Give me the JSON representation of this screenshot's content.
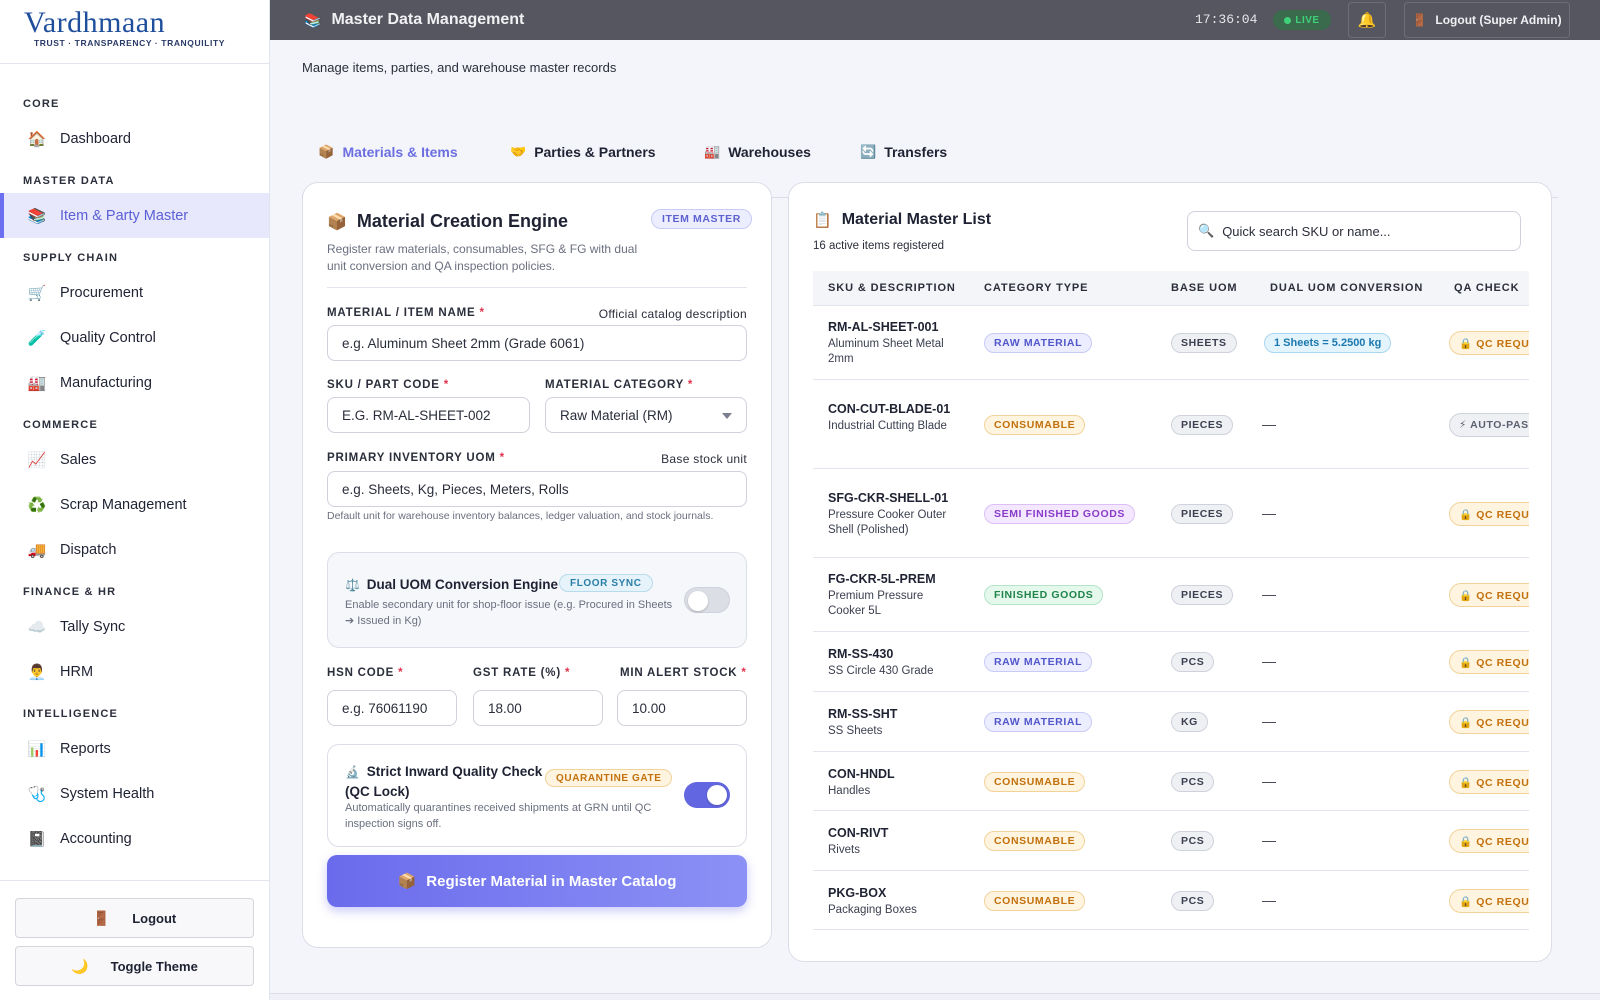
{
  "brand": {
    "name": "Vardhmaan",
    "tagline": "TRUST · TRANSPARENCY · TRANQUILITY",
    "accent": "#6c6ff0"
  },
  "sidebar": {
    "sections": {
      "core": "CORE",
      "master": "MASTER DATA",
      "supply": "SUPPLY CHAIN",
      "commerce": "COMMERCE",
      "finance": "FINANCE & HR",
      "intel": "INTELLIGENCE"
    },
    "items": {
      "dashboard": {
        "label": "Dashboard",
        "icon": "🏠"
      },
      "item_party": {
        "label": "Item & Party Master",
        "icon": "📚"
      },
      "procurement": {
        "label": "Procurement",
        "icon": "🛒"
      },
      "quality": {
        "label": "Quality Control",
        "icon": "🧪"
      },
      "manufacturing": {
        "label": "Manufacturing",
        "icon": "🏭"
      },
      "sales": {
        "label": "Sales",
        "icon": "📈"
      },
      "scrap": {
        "label": "Scrap Management",
        "icon": "♻️"
      },
      "dispatch": {
        "label": "Dispatch",
        "icon": "🚚"
      },
      "tally": {
        "label": "Tally Sync",
        "icon": "☁️"
      },
      "hrm": {
        "label": "HRM",
        "icon": "👨‍💼"
      },
      "reports": {
        "label": "Reports",
        "icon": "📊"
      },
      "health": {
        "label": "System Health",
        "icon": "🩺"
      },
      "accounting": {
        "label": "Accounting",
        "icon": "📓"
      }
    },
    "logout": {
      "label": "Logout",
      "icon": "🚪"
    },
    "theme": {
      "label": "Toggle Theme",
      "icon": "🌙"
    }
  },
  "topbar": {
    "icon": "📚",
    "title": "Master Data Management",
    "clock": "17:36:04",
    "live": "LIVE",
    "bell_icon": "🔔",
    "logout_icon": "🚪",
    "logout_label": "Logout (Super Admin)"
  },
  "main": {
    "subtitle": "Manage items, parties, and warehouse master records",
    "tabs": [
      {
        "label": "Materials & Items",
        "icon": "📦"
      },
      {
        "label": "Parties & Partners",
        "icon": "🤝"
      },
      {
        "label": "Warehouses",
        "icon": "🏭"
      },
      {
        "label": "Transfers",
        "icon": "🔄"
      }
    ]
  },
  "form": {
    "icon": "📦",
    "title": "Material Creation Engine",
    "badge": "ITEM MASTER",
    "description": "Register raw materials, consumables, SFG & FG with dual unit conversion and QA inspection policies.",
    "name_label": "MATERIAL / ITEM NAME",
    "name_hint": "Official catalog description",
    "name_placeholder": "e.g. Aluminum Sheet 2mm (Grade 6061)",
    "sku_label": "SKU / PART CODE",
    "sku_placeholder": "E.G. RM-AL-SHEET-002",
    "category_label": "MATERIAL CATEGORY",
    "category_value": "Raw Material (RM)",
    "uom_label": "PRIMARY INVENTORY UOM",
    "uom_hint": "Base stock unit",
    "uom_placeholder": "e.g. Sheets, Kg, Pieces, Meters, Rolls",
    "uom_note": "Default unit for warehouse inventory balances, ledger valuation, and stock journals.",
    "dual": {
      "icon": "⚖️",
      "title": "Dual UOM Conversion Engine",
      "badge": "FLOOR SYNC",
      "desc": "Enable secondary unit for shop-floor issue (e.g. Procured in Sheets ➔ Issued in Kg)",
      "enabled": false
    },
    "hsn_label": "HSN CODE",
    "hsn_placeholder": "e.g. 76061190",
    "gst_label": "GST RATE (%)",
    "gst_value": "18.00",
    "min_label": "MIN ALERT STOCK",
    "min_value": "10.00",
    "qc": {
      "icon": "🔬",
      "title_line1": "Strict Inward Quality Check",
      "title_line2": "(QC Lock)",
      "badge": "QUARANTINE GATE",
      "desc": "Automatically quarantines received shipments at GRN until QC inspection signs off.",
      "enabled": true
    },
    "submit_icon": "📦",
    "submit_label": "Register Material in Master Catalog"
  },
  "list": {
    "icon": "📋",
    "title": "Material Master List",
    "count": "16 active items registered",
    "search_icon": "🔍",
    "search_placeholder": "Quick search SKU or name...",
    "columns": [
      "SKU & DESCRIPTION",
      "CATEGORY TYPE",
      "BASE UOM",
      "DUAL UOM CONVERSION",
      "QA CHECK"
    ],
    "rows": [
      {
        "sku": "RM-AL-SHEET-001",
        "desc": "Aluminum Sheet Metal 2mm",
        "category": "RAW MATERIAL",
        "cat_class": "b-raw",
        "uom": "SHEETS",
        "conversion": "1 Sheets = 5.2500 kg",
        "qa": "🔒 QC REQUIRED",
        "qa_class": "b-qc"
      },
      {
        "sku": "CON-CUT-BLADE-01",
        "desc": "Industrial Cutting Blade",
        "category": "CONSUMABLE",
        "cat_class": "b-con",
        "uom": "PIECES",
        "conversion": "—",
        "qa": "⚡ AUTO-PASS",
        "qa_class": "b-auto"
      },
      {
        "sku": "SFG-CKR-SHELL-01",
        "desc": "Pressure Cooker Outer Shell (Polished)",
        "category": "SEMI FINISHED GOODS",
        "cat_class": "b-sfg",
        "uom": "PIECES",
        "conversion": "—",
        "qa": "🔒 QC REQUIRED",
        "qa_class": "b-qc"
      },
      {
        "sku": "FG-CKR-5L-PREM",
        "desc": "Premium Pressure Cooker 5L",
        "category": "FINISHED GOODS",
        "cat_class": "b-fg",
        "uom": "PIECES",
        "conversion": "—",
        "qa": "🔒 QC REQUIRED",
        "qa_class": "b-qc"
      },
      {
        "sku": "RM-SS-430",
        "desc": "SS Circle 430 Grade",
        "category": "RAW MATERIAL",
        "cat_class": "b-raw",
        "uom": "PCS",
        "conversion": "—",
        "qa": "🔒 QC REQUIRED",
        "qa_class": "b-qc"
      },
      {
        "sku": "RM-SS-SHT",
        "desc": "SS Sheets",
        "category": "RAW MATERIAL",
        "cat_class": "b-raw",
        "uom": "KG",
        "conversion": "—",
        "qa": "🔒 QC REQUIRED",
        "qa_class": "b-qc"
      },
      {
        "sku": "CON-HNDL",
        "desc": "Handles",
        "category": "CONSUMABLE",
        "cat_class": "b-con",
        "uom": "PCS",
        "conversion": "—",
        "qa": "🔒 QC REQUIRED",
        "qa_class": "b-qc"
      },
      {
        "sku": "CON-RIVT",
        "desc": "Rivets",
        "category": "CONSUMABLE",
        "cat_class": "b-con",
        "uom": "PCS",
        "conversion": "—",
        "qa": "🔒 QC REQUIRED",
        "qa_class": "b-qc"
      },
      {
        "sku": "PKG-BOX",
        "desc": "Packaging Boxes",
        "category": "CONSUMABLE",
        "cat_class": "b-con",
        "uom": "PCS",
        "conversion": "—",
        "qa": "🔒 QC REQUIRED",
        "qa_class": "b-qc"
      }
    ]
  }
}
